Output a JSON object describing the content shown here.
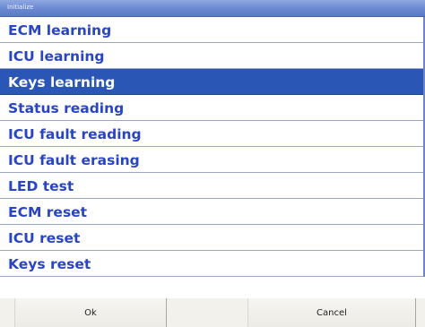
{
  "window": {
    "title": "Initialize"
  },
  "menu": {
    "items": [
      {
        "label": "ECM learning",
        "selected": false
      },
      {
        "label": "ICU learning",
        "selected": false
      },
      {
        "label": "Keys learning",
        "selected": true
      },
      {
        "label": "Status reading",
        "selected": false
      },
      {
        "label": "ICU fault reading",
        "selected": false
      },
      {
        "label": "ICU fault erasing",
        "selected": false
      },
      {
        "label": "LED test",
        "selected": false
      },
      {
        "label": "ECM reset",
        "selected": false
      },
      {
        "label": "ICU reset",
        "selected": false
      },
      {
        "label": "Keys reset",
        "selected": false
      }
    ]
  },
  "buttons": {
    "ok_label": "Ok",
    "cancel_label": "Cancel"
  },
  "colors": {
    "item_text": "#2a45c2",
    "selected_background": "#2a57b6",
    "selected_text": "#ffffff",
    "titlebar": "#6d8bd3"
  }
}
